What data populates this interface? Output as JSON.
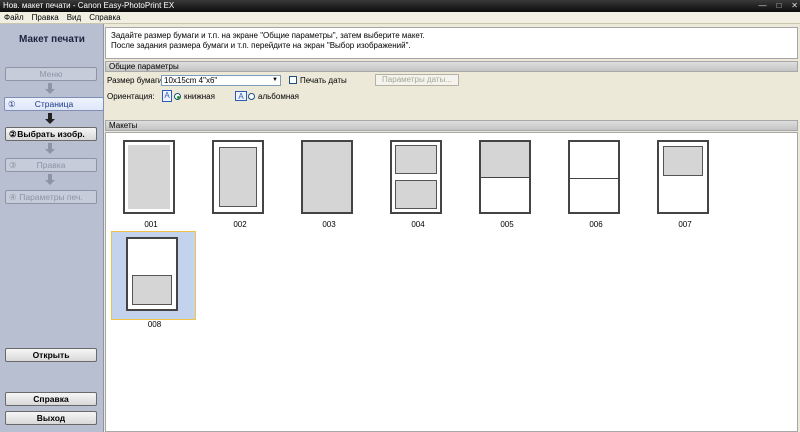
{
  "window": {
    "title": "Нов. макет печати - Canon Easy-PhotoPrint EX"
  },
  "menu": [
    "Файл",
    "Правка",
    "Вид",
    "Справка"
  ],
  "sidebar": {
    "title": "Макет печати",
    "steps": [
      {
        "label": "Меню",
        "num": ""
      },
      {
        "label": "Страница",
        "num": "①"
      },
      {
        "label": "Выбрать изобр.",
        "num": "②"
      },
      {
        "label": "Правка",
        "num": "③"
      },
      {
        "label": "Параметры печ.",
        "num": "④"
      }
    ],
    "open_label": "Открыть",
    "help_label": "Справка",
    "exit_label": "Выход"
  },
  "instructions": {
    "line1": "Задайте размер бумаги и т.п. на экране \"Общие параметры\", затем выберите макет.",
    "line2": "После задания размера бумаги и т.п. перейдите на экран \"Выбор изображений\"."
  },
  "general": {
    "header": "Общие параметры",
    "paper_size_label": "Размер бумаги:",
    "paper_size_value": "10x15cm 4\"x6\"",
    "print_date_label": "Печать даты",
    "date_settings_label": "Параметры даты...",
    "orientation_label": "Ориентация:",
    "portrait_label": "книжная",
    "landscape_label": "альбомная",
    "orientation_selected": "книжная"
  },
  "layouts": {
    "header": "Макеты",
    "selected": "008",
    "items": [
      "001",
      "002",
      "003",
      "004",
      "005",
      "006",
      "007",
      "008"
    ]
  },
  "colors": {
    "sidebar": "#b7bfd0",
    "selection": "#c3d3ed",
    "selection_border": "#f0c24a"
  },
  "icons": {
    "portrait": "portrait-orientation-icon",
    "landscape": "landscape-orientation-icon"
  }
}
